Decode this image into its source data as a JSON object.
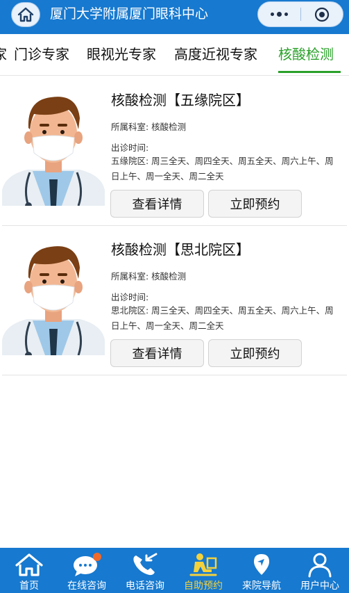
{
  "header": {
    "title": "厦门大学附属厦门眼科中心",
    "home_icon": "home-icon",
    "more_icon": "more-icon",
    "target_icon": "target-icon"
  },
  "tabs": [
    {
      "label": "家",
      "active": false
    },
    {
      "label": "门诊专家",
      "active": false
    },
    {
      "label": "眼视光专家",
      "active": false
    },
    {
      "label": "高度近视专家",
      "active": false
    },
    {
      "label": "核酸检测",
      "active": true
    }
  ],
  "doctors": [
    {
      "title": "核酸检测【五缘院区】",
      "dept": "所属科室: 核酸检测",
      "time_label": "出诊时间:",
      "time_text": "五缘院区:  周三全天、周四全天、周五全天、周六上午、周日上午、周一全天、周二全天",
      "detail_label": "查看详情",
      "book_label": "立即预约"
    },
    {
      "title": "核酸检测【思北院区】",
      "dept": "所属科室: 核酸检测",
      "time_label": "出诊时间:",
      "time_text": "思北院区:  周三全天、周四全天、周五全天、周六上午、周日上午、周一全天、周二全天",
      "detail_label": "查看详情",
      "book_label": "立即预约"
    }
  ],
  "bottom_nav": [
    {
      "label": "首页",
      "icon": "home-icon",
      "active": false
    },
    {
      "label": "在线咨询",
      "icon": "chat-icon",
      "active": false
    },
    {
      "label": "电话咨询",
      "icon": "phone-icon",
      "active": false
    },
    {
      "label": "自助预约",
      "icon": "self-booking-icon",
      "active": true
    },
    {
      "label": "来院导航",
      "icon": "location-icon",
      "active": false
    },
    {
      "label": "用户中心",
      "icon": "user-icon",
      "active": false
    }
  ],
  "colors": {
    "primary": "#1779cf",
    "active_tab": "#2aa12a",
    "active_nav": "#f4d23c",
    "badge": "#f06a2a"
  }
}
